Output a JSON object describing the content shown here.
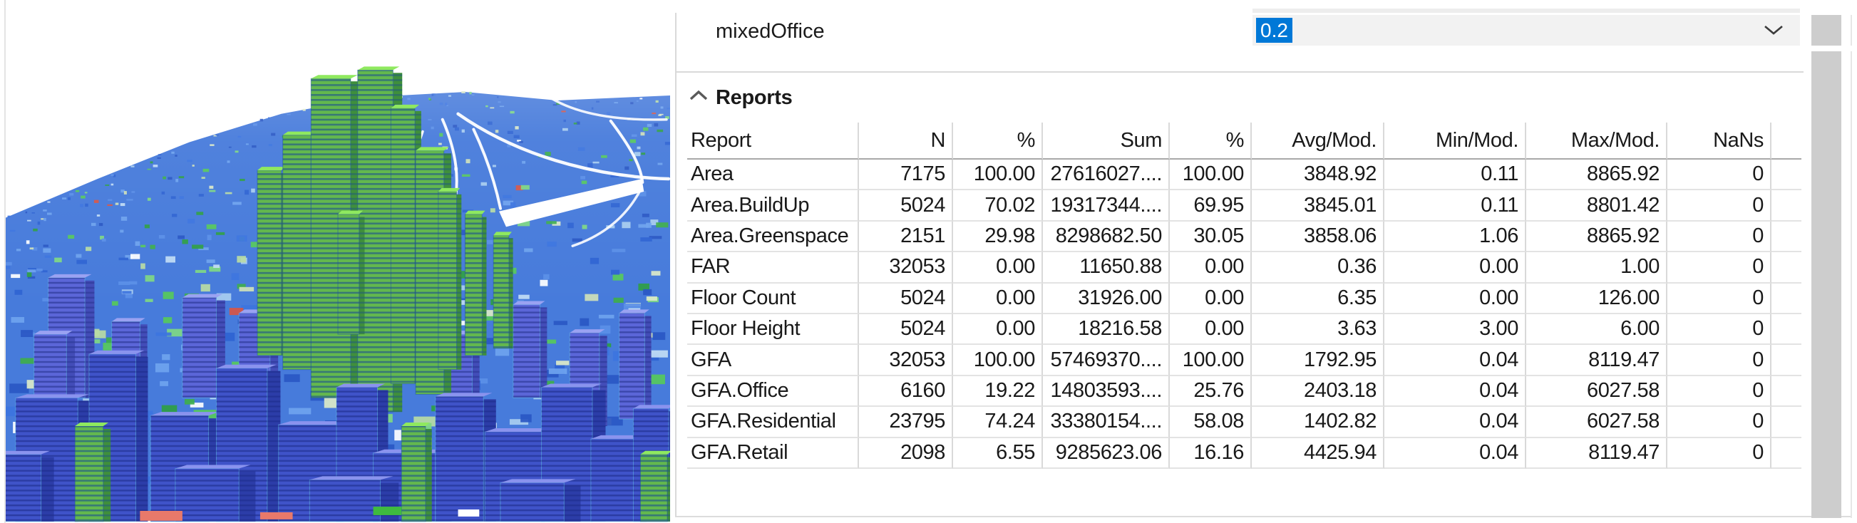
{
  "parameter": {
    "name": "mixedOffice",
    "value": "0.2"
  },
  "reports": {
    "title": "Reports",
    "table": {
      "columns": [
        "Report",
        "N",
        "%",
        "Sum",
        "%",
        "Avg/Mod.",
        "Min/Mod.",
        "Max/Mod.",
        "NaNs"
      ],
      "rows": [
        [
          "Area",
          "7175",
          "100.00",
          "27616027....",
          "100.00",
          "3848.92",
          "0.11",
          "8865.92",
          "0"
        ],
        [
          "Area.BuildUp",
          "5024",
          "70.02",
          "19317344....",
          "69.95",
          "3845.01",
          "0.11",
          "8801.42",
          "0"
        ],
        [
          "Area.Greenspace",
          "2151",
          "29.98",
          "8298682.50",
          "30.05",
          "3858.06",
          "1.06",
          "8865.92",
          "0"
        ],
        [
          "FAR",
          "32053",
          "0.00",
          "11650.88",
          "0.00",
          "0.36",
          "0.00",
          "1.00",
          "0"
        ],
        [
          "Floor Count",
          "5024",
          "0.00",
          "31926.00",
          "0.00",
          "6.35",
          "0.00",
          "126.00",
          "0"
        ],
        [
          "Floor Height",
          "5024",
          "0.00",
          "18216.58",
          "0.00",
          "3.63",
          "3.00",
          "6.00",
          "0"
        ],
        [
          "GFA",
          "32053",
          "100.00",
          "57469370....",
          "100.00",
          "1792.95",
          "0.04",
          "8119.47",
          "0"
        ],
        [
          "GFA.Office",
          "6160",
          "19.22",
          "14803593....",
          "25.76",
          "2403.18",
          "0.04",
          "6027.58",
          "0"
        ],
        [
          "GFA.Residential",
          "23795",
          "74.24",
          "33380154....",
          "58.08",
          "1402.82",
          "0.04",
          "6027.58",
          "0"
        ],
        [
          "GFA.Retail",
          "2098",
          "6.55",
          "9285623.06",
          "16.16",
          "4425.94",
          "0.04",
          "8119.47",
          "0"
        ]
      ]
    }
  },
  "icons": {
    "combo_dropdown": "chevron-down-icon",
    "reports_collapse": "chevron-up-icon"
  },
  "colors": {
    "selection_blue": "#0078d7",
    "scrollbar_gray": "#cdcdcd"
  }
}
